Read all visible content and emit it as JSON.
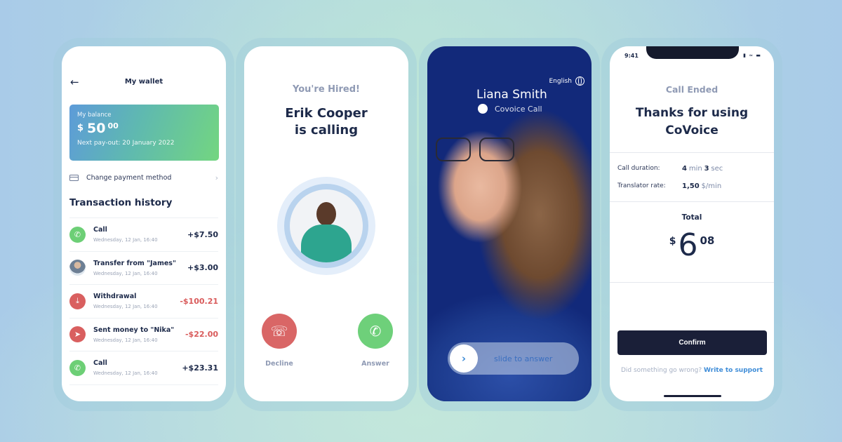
{
  "wallet": {
    "title": "My wallet",
    "back_icon": "arrow-left-icon",
    "balance_label": "My balance",
    "balance_currency": "$",
    "balance_whole": "50",
    "balance_cents": "00",
    "next_payout": "Next pay-out: 20 January 2022",
    "payment_method_label": "Change payment method",
    "history_title": "Transaction history",
    "transactions": [
      {
        "name": "Call",
        "date": "Wednesday, 12 Jan, 16:40",
        "amount": "+$7.50",
        "icon": "phone-icon",
        "type": "credit"
      },
      {
        "name": "Transfer from \"James\"",
        "date": "Wednesday, 12 Jan, 16:40",
        "amount": "+$3.00",
        "icon": "avatar",
        "type": "credit"
      },
      {
        "name": "Withdrawal",
        "date": "Wednesday, 12 Jan, 16:40",
        "amount": "-$100.21",
        "icon": "download-icon",
        "type": "debit"
      },
      {
        "name": "Sent money to \"Nika\"",
        "date": "Wednesday, 12 Jan, 16:40",
        "amount": "-$22.00",
        "icon": "send-circle-icon",
        "type": "debit"
      },
      {
        "name": "Call",
        "date": "Wednesday, 12 Jan, 16:40",
        "amount": "+$23.31",
        "icon": "phone-icon",
        "type": "credit"
      }
    ]
  },
  "incoming": {
    "subtitle": "You're Hired!",
    "caller_line1": "Erik Cooper",
    "caller_line2": "is calling",
    "decline_label": "Decline",
    "answer_label": "Answer"
  },
  "video_call": {
    "language": "English",
    "callee_name": "Liana Smith",
    "call_type": "Covoice Call",
    "slider_text": "slide to answer"
  },
  "summary": {
    "status_time": "9:41",
    "title": "Call Ended",
    "thanks_line1": "Thanks for using",
    "thanks_line2": "CoVoice",
    "duration_label": "Call duration:",
    "duration_min": "4",
    "duration_min_unit": "min",
    "duration_sec": "3",
    "duration_sec_unit": "sec",
    "rate_label": "Translator rate:",
    "rate_value": "1,50",
    "rate_unit": "$/min",
    "total_label": "Total",
    "total_currency": "$",
    "total_whole": "6",
    "total_cents": "08",
    "confirm_label": "Confirm",
    "support_prefix": "Did something go wrong?",
    "support_link": "Write to support"
  },
  "colors": {
    "navy": "#1d2a4a",
    "green": "#6dcf76",
    "red": "#d95f5f",
    "link": "#3f8dd8"
  }
}
